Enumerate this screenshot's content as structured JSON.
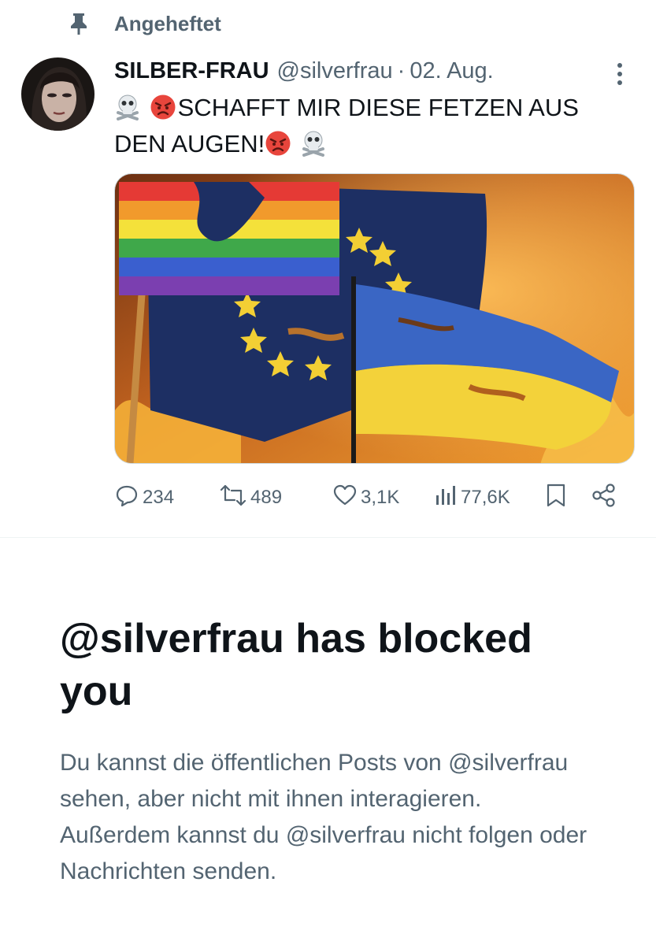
{
  "pinned": {
    "label": "Angeheftet",
    "icon": "pin-icon"
  },
  "tweet": {
    "author": {
      "display_name": "SILBER-FRAU",
      "handle": "@silverfrau",
      "avatar_icon": "avatar"
    },
    "separator": "·",
    "date": "02. Aug.",
    "text": {
      "line1": "SCHAFFT MIR DIESE FETZEN AUS",
      "line2": "DEN AUGEN!",
      "emojis": [
        "skull-and-crossbones-icon",
        "angry-face-icon"
      ]
    },
    "media": {
      "description_icon": "burning-flags-image"
    },
    "actions": {
      "replies": "234",
      "retweets": "489",
      "likes": "3,1K",
      "views": "77,6K"
    }
  },
  "blocked_notice": {
    "title": "@silverfrau has blocked you",
    "description": "Du kannst die öffentlichen Posts von @silverfrau sehen, aber nicht mit ihnen interagieren. Außerdem kannst du @silverfrau nicht folgen oder Nachrichten senden."
  },
  "colors": {
    "text_primary": "#0f1419",
    "text_secondary": "#536471",
    "divider": "#eff3f4",
    "background": "#ffffff"
  }
}
